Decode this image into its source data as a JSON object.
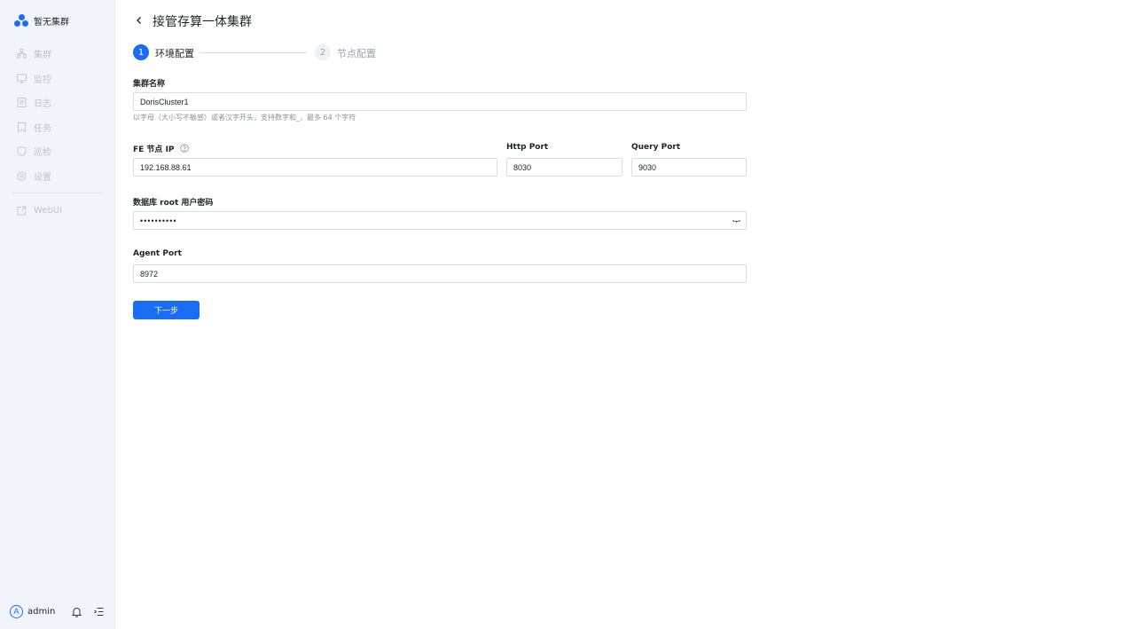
{
  "app": {
    "brand_name": "暂无集群",
    "accent_color": "#1a6cf5"
  },
  "sidebar": {
    "items": [
      {
        "label": "集群",
        "icon": "cluster-icon"
      },
      {
        "label": "监控",
        "icon": "monitor-icon"
      },
      {
        "label": "日志",
        "icon": "log-icon"
      },
      {
        "label": "任务",
        "icon": "task-icon"
      },
      {
        "label": "巡检",
        "icon": "inspection-icon"
      },
      {
        "label": "设置",
        "icon": "settings-icon"
      }
    ],
    "webui_label": "WebUI",
    "user": {
      "avatar_letter": "A",
      "name": "admin"
    }
  },
  "header": {
    "title": "接管存算一体集群"
  },
  "steps": [
    {
      "number": "1",
      "label": "环境配置",
      "status": "active"
    },
    {
      "number": "2",
      "label": "节点配置",
      "status": "pending"
    }
  ],
  "form": {
    "cluster_name": {
      "label": "集群名称",
      "value": "DorisCluster1",
      "hint": "以字母（大小写不敏感）或者汉字开头，支持数字和_，最多 64 个字符"
    },
    "fe_ip": {
      "label": "FE 节点 IP",
      "value": "192.168.88.61"
    },
    "http_port": {
      "label": "Http Port",
      "value": "8030"
    },
    "query_port": {
      "label": "Query Port",
      "value": "9030"
    },
    "root_password": {
      "label": "数据库 root 用户密码",
      "value": "••••••••••"
    },
    "agent_port": {
      "label": "Agent Port",
      "value": "8972"
    },
    "next_button": "下一步"
  }
}
